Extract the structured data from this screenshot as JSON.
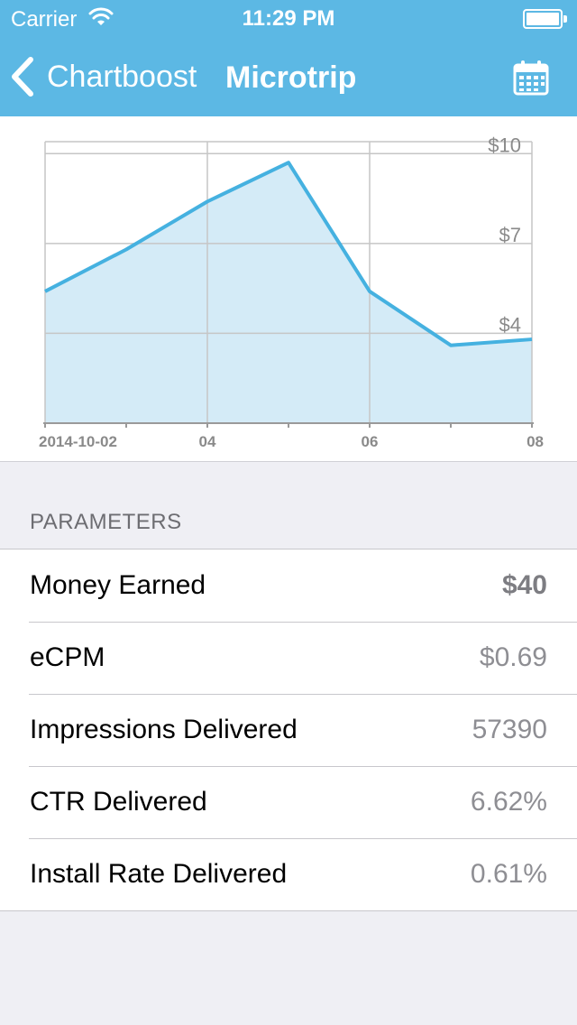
{
  "status_bar": {
    "carrier": "Carrier",
    "time": "11:29 PM",
    "icons": [
      "wifi-icon",
      "battery-icon"
    ]
  },
  "nav_bar": {
    "back_label": "Chartboost",
    "title": "Microtrip",
    "icons": [
      "chevron-left-icon",
      "calendar-icon"
    ]
  },
  "colors": {
    "header_background": "#5cb8e4",
    "chart_line": "#45b1e0",
    "chart_fill": "#d4ebf7",
    "page_background": "#efeff4"
  },
  "chart_data": {
    "type": "area",
    "x": [
      "2014-10-02",
      "2014-10-03",
      "2014-10-04",
      "2014-10-05",
      "2014-10-06",
      "2014-10-07",
      "2014-10-08"
    ],
    "values": [
      5.4,
      6.8,
      8.4,
      9.7,
      5.4,
      3.6,
      3.8
    ],
    "x_tick_labels": [
      {
        "x": "2014-10-02",
        "label": "2014-10-02"
      },
      {
        "x": "2014-10-04",
        "label": "04"
      },
      {
        "x": "2014-10-06",
        "label": "06"
      },
      {
        "x": "2014-10-08",
        "label": "08"
      }
    ],
    "y_ticks": [
      {
        "value": 10,
        "label": "$10"
      },
      {
        "value": 7,
        "label": "$7"
      },
      {
        "value": 4,
        "label": "$4"
      }
    ],
    "ylim": [
      1,
      10.4
    ],
    "y_axis_position": "right",
    "grid": true
  },
  "parameters": {
    "section_title": "PARAMETERS",
    "rows": [
      {
        "label": "Money Earned",
        "value": "$40",
        "bold": true
      },
      {
        "label": "eCPM",
        "value": "$0.69",
        "bold": false
      },
      {
        "label": "Impressions Delivered",
        "value": "57390",
        "bold": false
      },
      {
        "label": "CTR Delivered",
        "value": "6.62%",
        "bold": false
      },
      {
        "label": "Install Rate Delivered",
        "value": "0.61%",
        "bold": false
      }
    ]
  }
}
